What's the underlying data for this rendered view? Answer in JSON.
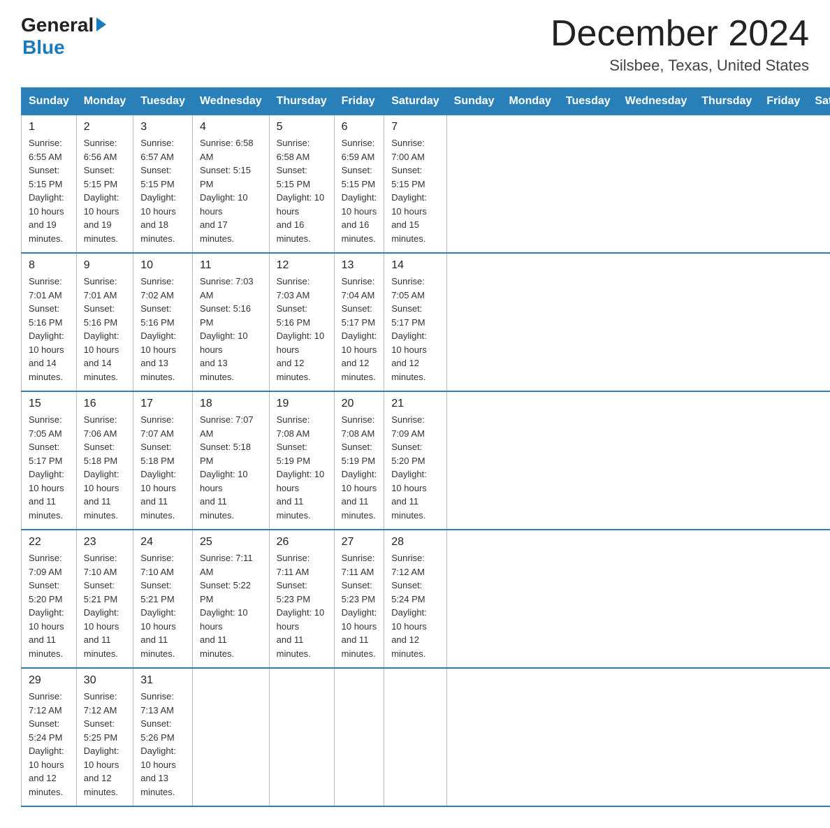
{
  "header": {
    "logo_general": "General",
    "logo_blue": "Blue",
    "month_title": "December 2024",
    "location": "Silsbee, Texas, United States"
  },
  "days_of_week": [
    "Sunday",
    "Monday",
    "Tuesday",
    "Wednesday",
    "Thursday",
    "Friday",
    "Saturday"
  ],
  "weeks": [
    [
      {
        "day": "1",
        "info": "Sunrise: 6:55 AM\nSunset: 5:15 PM\nDaylight: 10 hours\nand 19 minutes."
      },
      {
        "day": "2",
        "info": "Sunrise: 6:56 AM\nSunset: 5:15 PM\nDaylight: 10 hours\nand 19 minutes."
      },
      {
        "day": "3",
        "info": "Sunrise: 6:57 AM\nSunset: 5:15 PM\nDaylight: 10 hours\nand 18 minutes."
      },
      {
        "day": "4",
        "info": "Sunrise: 6:58 AM\nSunset: 5:15 PM\nDaylight: 10 hours\nand 17 minutes."
      },
      {
        "day": "5",
        "info": "Sunrise: 6:58 AM\nSunset: 5:15 PM\nDaylight: 10 hours\nand 16 minutes."
      },
      {
        "day": "6",
        "info": "Sunrise: 6:59 AM\nSunset: 5:15 PM\nDaylight: 10 hours\nand 16 minutes."
      },
      {
        "day": "7",
        "info": "Sunrise: 7:00 AM\nSunset: 5:15 PM\nDaylight: 10 hours\nand 15 minutes."
      }
    ],
    [
      {
        "day": "8",
        "info": "Sunrise: 7:01 AM\nSunset: 5:16 PM\nDaylight: 10 hours\nand 14 minutes."
      },
      {
        "day": "9",
        "info": "Sunrise: 7:01 AM\nSunset: 5:16 PM\nDaylight: 10 hours\nand 14 minutes."
      },
      {
        "day": "10",
        "info": "Sunrise: 7:02 AM\nSunset: 5:16 PM\nDaylight: 10 hours\nand 13 minutes."
      },
      {
        "day": "11",
        "info": "Sunrise: 7:03 AM\nSunset: 5:16 PM\nDaylight: 10 hours\nand 13 minutes."
      },
      {
        "day": "12",
        "info": "Sunrise: 7:03 AM\nSunset: 5:16 PM\nDaylight: 10 hours\nand 12 minutes."
      },
      {
        "day": "13",
        "info": "Sunrise: 7:04 AM\nSunset: 5:17 PM\nDaylight: 10 hours\nand 12 minutes."
      },
      {
        "day": "14",
        "info": "Sunrise: 7:05 AM\nSunset: 5:17 PM\nDaylight: 10 hours\nand 12 minutes."
      }
    ],
    [
      {
        "day": "15",
        "info": "Sunrise: 7:05 AM\nSunset: 5:17 PM\nDaylight: 10 hours\nand 11 minutes."
      },
      {
        "day": "16",
        "info": "Sunrise: 7:06 AM\nSunset: 5:18 PM\nDaylight: 10 hours\nand 11 minutes."
      },
      {
        "day": "17",
        "info": "Sunrise: 7:07 AM\nSunset: 5:18 PM\nDaylight: 10 hours\nand 11 minutes."
      },
      {
        "day": "18",
        "info": "Sunrise: 7:07 AM\nSunset: 5:18 PM\nDaylight: 10 hours\nand 11 minutes."
      },
      {
        "day": "19",
        "info": "Sunrise: 7:08 AM\nSunset: 5:19 PM\nDaylight: 10 hours\nand 11 minutes."
      },
      {
        "day": "20",
        "info": "Sunrise: 7:08 AM\nSunset: 5:19 PM\nDaylight: 10 hours\nand 11 minutes."
      },
      {
        "day": "21",
        "info": "Sunrise: 7:09 AM\nSunset: 5:20 PM\nDaylight: 10 hours\nand 11 minutes."
      }
    ],
    [
      {
        "day": "22",
        "info": "Sunrise: 7:09 AM\nSunset: 5:20 PM\nDaylight: 10 hours\nand 11 minutes."
      },
      {
        "day": "23",
        "info": "Sunrise: 7:10 AM\nSunset: 5:21 PM\nDaylight: 10 hours\nand 11 minutes."
      },
      {
        "day": "24",
        "info": "Sunrise: 7:10 AM\nSunset: 5:21 PM\nDaylight: 10 hours\nand 11 minutes."
      },
      {
        "day": "25",
        "info": "Sunrise: 7:11 AM\nSunset: 5:22 PM\nDaylight: 10 hours\nand 11 minutes."
      },
      {
        "day": "26",
        "info": "Sunrise: 7:11 AM\nSunset: 5:23 PM\nDaylight: 10 hours\nand 11 minutes."
      },
      {
        "day": "27",
        "info": "Sunrise: 7:11 AM\nSunset: 5:23 PM\nDaylight: 10 hours\nand 11 minutes."
      },
      {
        "day": "28",
        "info": "Sunrise: 7:12 AM\nSunset: 5:24 PM\nDaylight: 10 hours\nand 12 minutes."
      }
    ],
    [
      {
        "day": "29",
        "info": "Sunrise: 7:12 AM\nSunset: 5:24 PM\nDaylight: 10 hours\nand 12 minutes."
      },
      {
        "day": "30",
        "info": "Sunrise: 7:12 AM\nSunset: 5:25 PM\nDaylight: 10 hours\nand 12 minutes."
      },
      {
        "day": "31",
        "info": "Sunrise: 7:13 AM\nSunset: 5:26 PM\nDaylight: 10 hours\nand 13 minutes."
      },
      {
        "day": "",
        "info": ""
      },
      {
        "day": "",
        "info": ""
      },
      {
        "day": "",
        "info": ""
      },
      {
        "day": "",
        "info": ""
      }
    ]
  ]
}
